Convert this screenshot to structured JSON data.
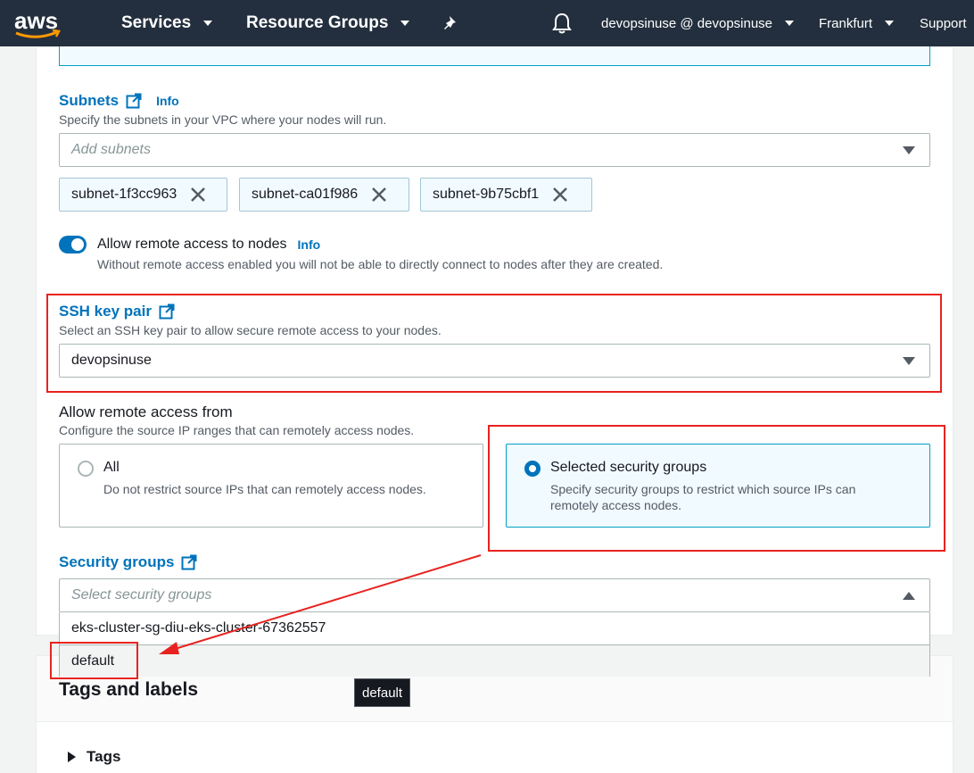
{
  "nav": {
    "logo_text": "aws",
    "services": "Services",
    "resource_groups": "Resource Groups",
    "account": "devopsinuse @ devopsinuse",
    "region": "Frankfurt",
    "support": "Support"
  },
  "subnets": {
    "title": "Subnets",
    "info": "Info",
    "description": "Specify the subnets in your VPC where your nodes will run.",
    "placeholder": "Add subnets",
    "tokens": [
      "subnet-1f3cc963",
      "subnet-ca01f986",
      "subnet-9b75cbf1"
    ]
  },
  "remote_access": {
    "label": "Allow remote access to nodes",
    "info": "Info",
    "description": "Without remote access enabled you will not be able to directly connect to nodes after they are created.",
    "enabled": true
  },
  "ssh": {
    "title": "SSH key pair",
    "description": "Select an SSH key pair to allow secure remote access to your nodes.",
    "value": "devopsinuse"
  },
  "access_from": {
    "title": "Allow remote access from",
    "description": "Configure the source IP ranges that can remotely access nodes.",
    "options": [
      {
        "title": "All",
        "description": "Do not restrict source IPs that can remotely access nodes.",
        "selected": false
      },
      {
        "title": "Selected security groups",
        "description": "Specify security groups to restrict which source IPs can remotely access nodes.",
        "selected": true
      }
    ]
  },
  "security_groups": {
    "title": "Security groups",
    "placeholder": "Select security groups",
    "options": [
      "eks-cluster-sg-diu-eks-cluster-67362557",
      "default"
    ],
    "tooltip": "default"
  },
  "tags": {
    "section_title": "Tags and labels",
    "expander": "Tags"
  },
  "colors": {
    "nav_bg": "#232f3e",
    "link_blue": "#0073bb",
    "highlight_red": "#e8231f"
  }
}
